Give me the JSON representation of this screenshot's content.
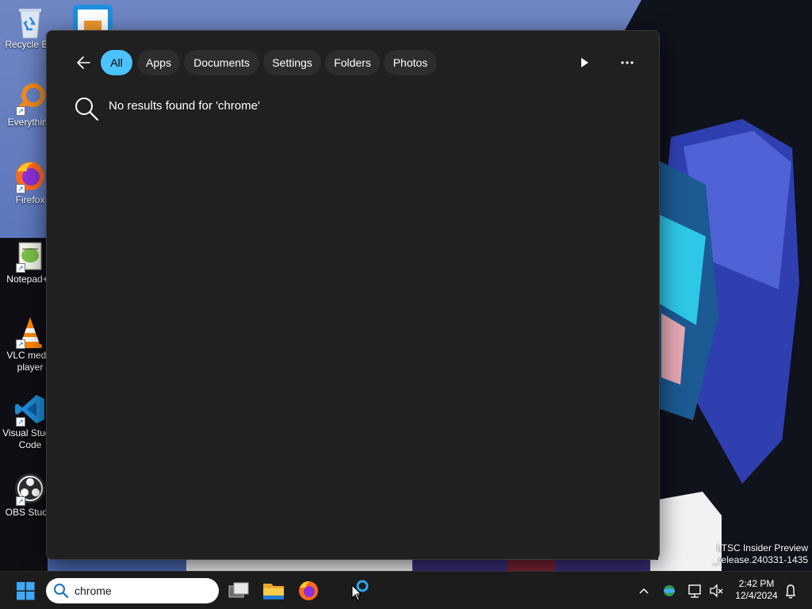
{
  "desktop": {
    "icons": [
      {
        "label": "Recycle Bin",
        "icon": "recycle-bin-icon"
      },
      {
        "label": "Everything",
        "icon": "everything-icon"
      },
      {
        "label": "Firefox",
        "icon": "firefox-icon"
      },
      {
        "label": "Notepad++",
        "icon": "notepad-plus-plus-icon"
      },
      {
        "label": "VLC media player",
        "icon": "vlc-icon"
      },
      {
        "label": "Visual Studio Code",
        "icon": "vscode-icon"
      },
      {
        "label": "OBS Studio",
        "icon": "obs-icon"
      }
    ],
    "watermark_line1": "LTSC Insider Preview",
    "watermark_line2": "_release.240331-1435"
  },
  "search": {
    "filters": [
      "All",
      "Apps",
      "Documents",
      "Settings",
      "Folders",
      "Photos"
    ],
    "active_filter": "All",
    "no_results_text": "No results found for 'chrome'"
  },
  "taskbar": {
    "search_value": "chrome",
    "time": "2:42 PM",
    "date": "12/4/2024"
  },
  "colors": {
    "accent": "#4cc2ff",
    "flyout_bg": "#202020",
    "chip_bg": "#2d2d2d",
    "taskbar_bg": "#1c1c1c"
  }
}
